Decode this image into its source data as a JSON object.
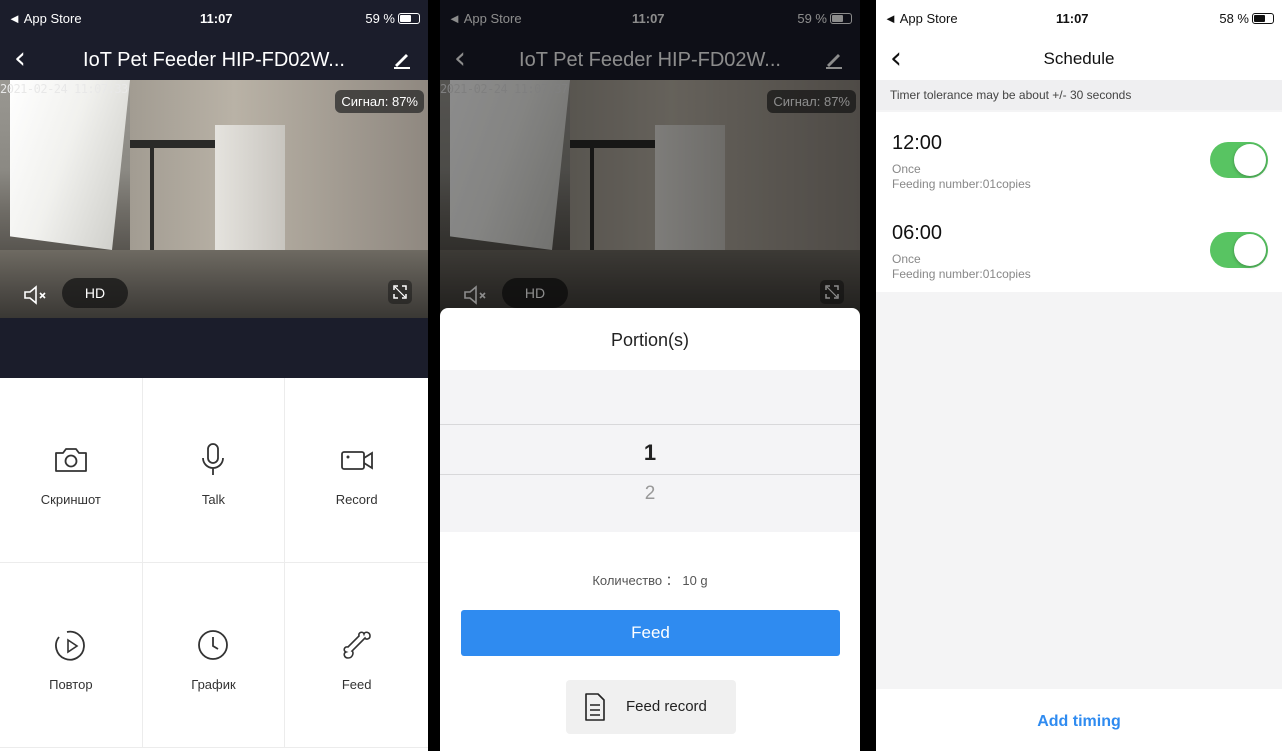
{
  "status_bar": {
    "carrier": "◄ App Store",
    "time": "11:07",
    "battery_p1": "59 %",
    "battery_p2": "59 %",
    "battery_p3": "58 %"
  },
  "device_screen": {
    "title": "IoT Pet Feeder HIP-FD02W...",
    "timestamp_p1": "2021-02-24 11:07:33",
    "timestamp_p2": "2021-02-24 11:07:37",
    "signal": "Сигнал: 87%",
    "quality": "HD",
    "actions": [
      {
        "label": "Скриншот",
        "icon": "camera-icon"
      },
      {
        "label": "Talk",
        "icon": "microphone-icon"
      },
      {
        "label": "Record",
        "icon": "video-record-icon"
      },
      {
        "label": "Повтор",
        "icon": "playback-icon"
      },
      {
        "label": "График",
        "icon": "clock-icon"
      },
      {
        "label": "Feed",
        "icon": "bone-icon"
      }
    ]
  },
  "portion_sheet": {
    "title": "Portion(s)",
    "selected": "1",
    "next": "2",
    "quantity": "Количество ： 10 g",
    "feed_button": "Feed",
    "feed_record_button": "Feed record"
  },
  "schedule": {
    "title": "Schedule",
    "tolerance_note": "Timer tolerance may be about +/- 30 seconds",
    "items": [
      {
        "time": "12:00",
        "repeat": "Once",
        "feeding": "Feeding number:01copies",
        "enabled": true
      },
      {
        "time": "06:00",
        "repeat": "Once",
        "feeding": "Feeding number:01copies",
        "enabled": true
      }
    ],
    "add_button": "Add timing"
  },
  "colors": {
    "accent_blue": "#2f8bf0",
    "toggle_green": "#58c462",
    "dark_bg": "#1b1d2b"
  }
}
